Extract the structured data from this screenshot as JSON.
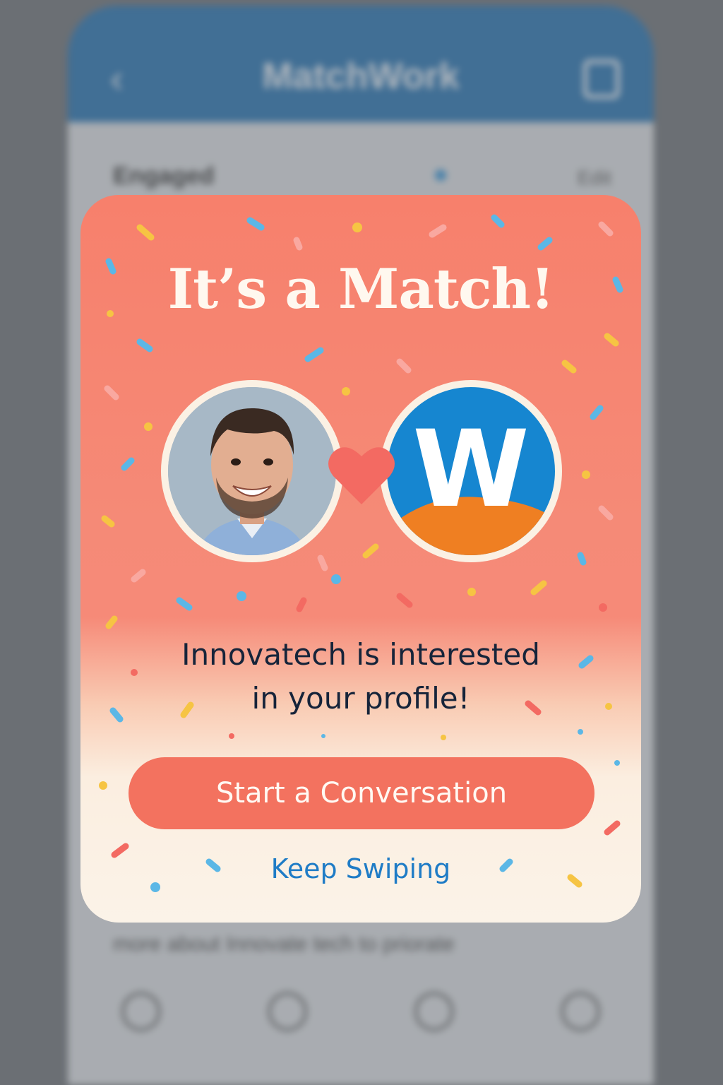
{
  "background_app": {
    "title": "MatchWork",
    "back_icon": "chevron-left-icon",
    "menu_icon": "menu-icon",
    "row_label": "Engaged",
    "row_meta": "Edit",
    "footer_text": "more about Innovate tech to priorate",
    "nav_icons": [
      "person-icon",
      "chat-icon",
      "circle-icon",
      "settings-icon"
    ]
  },
  "match_modal": {
    "title": "It’s a Match!",
    "message_line1": "Innovatech is interested",
    "message_line2": "in your profile!",
    "primary_button": "Start a Conversation",
    "secondary_button": "Keep Swiping",
    "company_logo_letter": "W",
    "heart_icon": "heart-icon"
  },
  "colors": {
    "card_top": "#f7806c",
    "card_bottom": "#fbf3e8",
    "button": "#f3725f",
    "link": "#1f7cc6",
    "logo_blue": "#1686d0",
    "logo_orange": "#ef7f22",
    "heart": "#f36a62"
  }
}
